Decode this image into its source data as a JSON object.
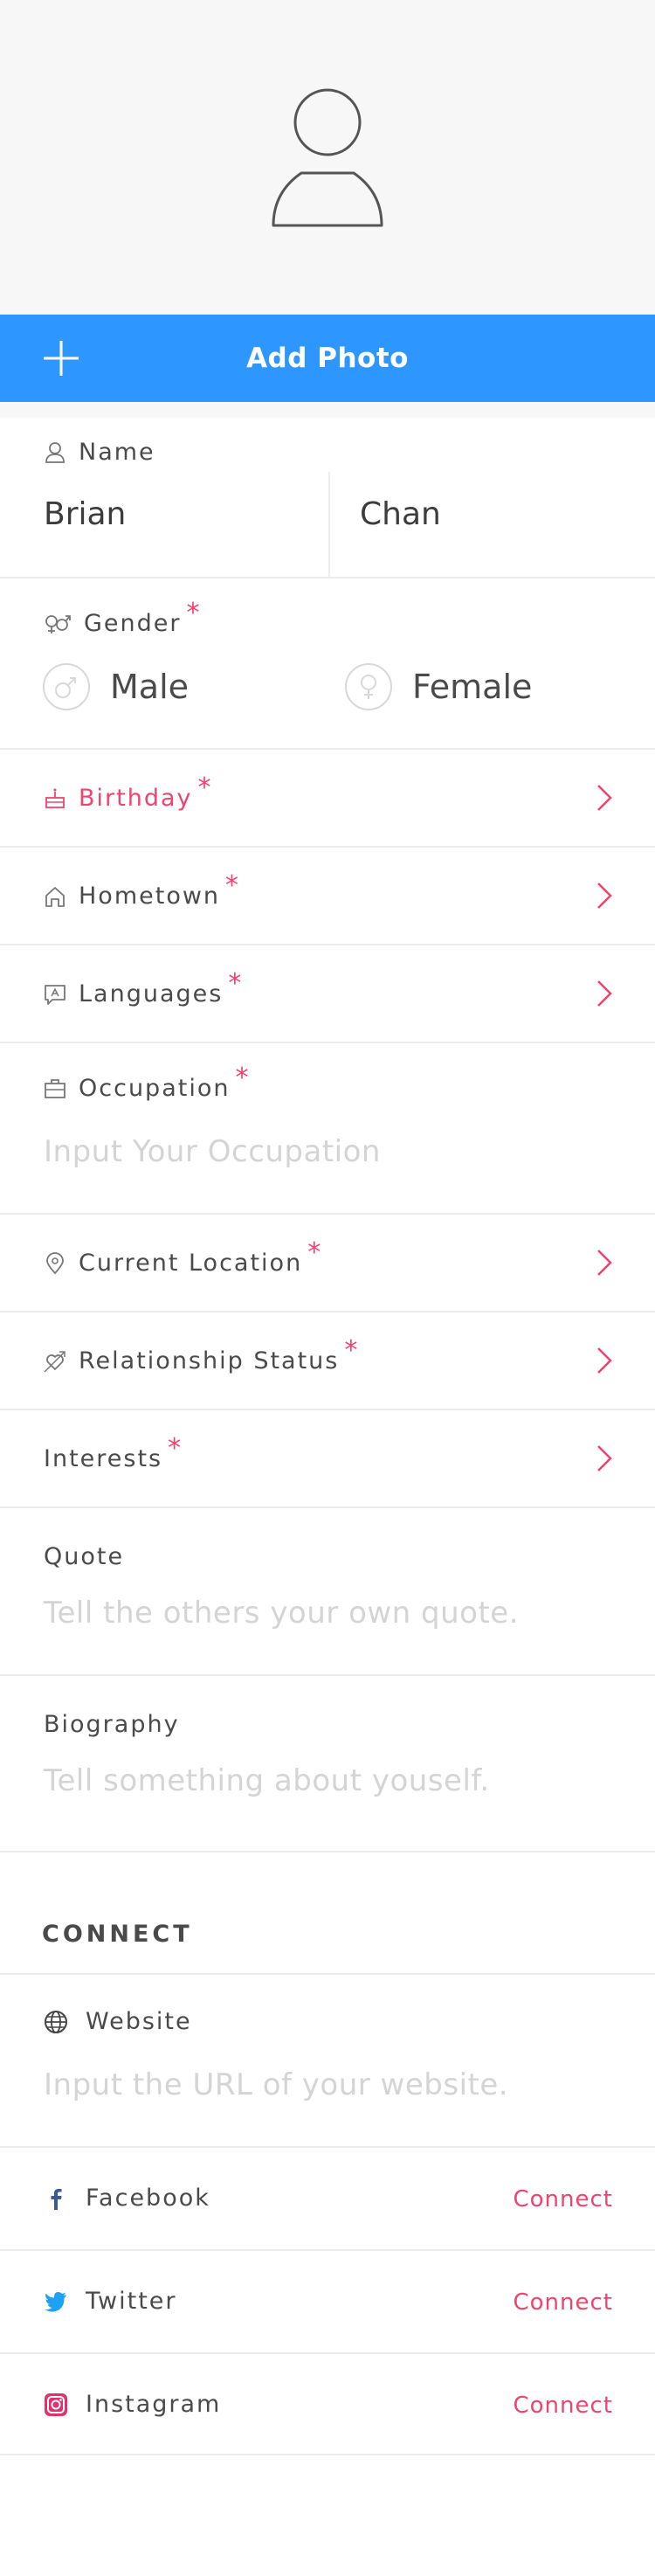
{
  "profile": {
    "add_photo_label": "Add Photo"
  },
  "form": {
    "name_label": "Name",
    "first_name": "Brian",
    "last_name": "Chan",
    "gender_label": "Gender",
    "gender_male": "Male",
    "gender_female": "Female",
    "birthday_label": "Birthday",
    "hometown_label": "Hometown",
    "languages_label": "Languages",
    "occupation_label": "Occupation",
    "occupation_placeholder": "Input Your Occupation",
    "current_location_label": "Current Location",
    "relationship_status_label": "Relationship Status",
    "interests_label": "Interests",
    "quote_label": "Quote",
    "quote_placeholder": "Tell the others your own quote.",
    "biography_label": "Biography",
    "biography_placeholder": "Tell something about youself.",
    "required_marker": "*"
  },
  "connect": {
    "section_title": "CONNECT",
    "website_label": "Website",
    "website_placeholder": "Input the URL of your website.",
    "facebook_label": "Facebook",
    "twitter_label": "Twitter",
    "instagram_label": "Instagram",
    "connect_label": "Connect"
  },
  "colors": {
    "accent_blue": "#2d97ff",
    "accent_pink": "#f0436e",
    "facebook_blue": "#3b5998",
    "twitter_blue": "#1da1f2",
    "instagram_pink": "#e1306c"
  },
  "icons": [
    "user-placeholder-icon",
    "plus-icon",
    "person-icon",
    "gender-icon",
    "male-icon",
    "female-icon",
    "cake-icon",
    "home-icon",
    "language-icon",
    "briefcase-icon",
    "location-pin-icon",
    "heart-arrow-icon",
    "chevron-right-icon",
    "globe-icon",
    "facebook-icon",
    "twitter-icon",
    "instagram-icon"
  ]
}
